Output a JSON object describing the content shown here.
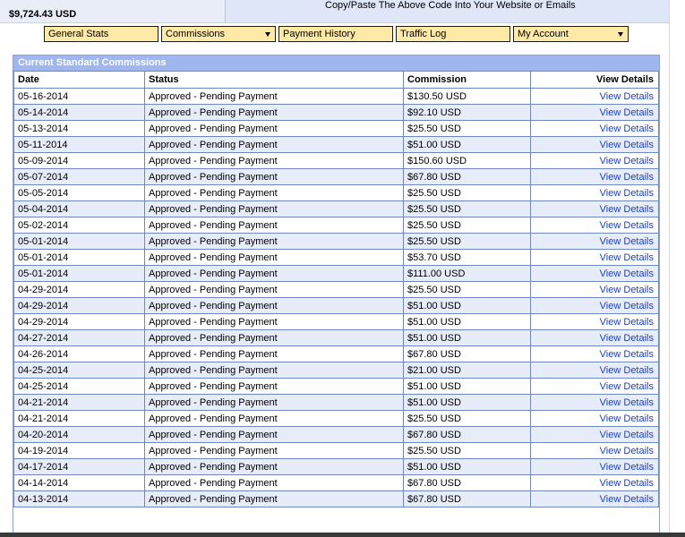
{
  "header": {
    "balance": "$9,724.43 USD",
    "copy_note": "Copy/Paste The Above Code Into Your Website or Emails"
  },
  "nav": [
    {
      "label": "General Stats",
      "dropdown": false
    },
    {
      "label": "Commissions",
      "dropdown": true
    },
    {
      "label": "Payment History",
      "dropdown": false
    },
    {
      "label": "Traffic Log",
      "dropdown": false
    },
    {
      "label": "My Account",
      "dropdown": true
    }
  ],
  "panel": {
    "title": "Current Standard Commissions",
    "columns": [
      "Date",
      "Status",
      "Commission",
      "View Details"
    ],
    "rows": [
      {
        "date": "05-16-2014",
        "status": "Approved - Pending Payment",
        "commission": "$130.50 USD",
        "link": "View Details"
      },
      {
        "date": "05-14-2014",
        "status": "Approved - Pending Payment",
        "commission": "$92.10 USD",
        "link": "View Details"
      },
      {
        "date": "05-13-2014",
        "status": "Approved - Pending Payment",
        "commission": "$25.50 USD",
        "link": "View Details"
      },
      {
        "date": "05-11-2014",
        "status": "Approved - Pending Payment",
        "commission": "$51.00 USD",
        "link": "View Details"
      },
      {
        "date": "05-09-2014",
        "status": "Approved - Pending Payment",
        "commission": "$150.60 USD",
        "link": "View Details"
      },
      {
        "date": "05-07-2014",
        "status": "Approved - Pending Payment",
        "commission": "$67.80 USD",
        "link": "View Details"
      },
      {
        "date": "05-05-2014",
        "status": "Approved - Pending Payment",
        "commission": "$25.50 USD",
        "link": "View Details"
      },
      {
        "date": "05-04-2014",
        "status": "Approved - Pending Payment",
        "commission": "$25.50 USD",
        "link": "View Details"
      },
      {
        "date": "05-02-2014",
        "status": "Approved - Pending Payment",
        "commission": "$25.50 USD",
        "link": "View Details"
      },
      {
        "date": "05-01-2014",
        "status": "Approved - Pending Payment",
        "commission": "$25.50 USD",
        "link": "View Details"
      },
      {
        "date": "05-01-2014",
        "status": "Approved - Pending Payment",
        "commission": "$53.70 USD",
        "link": "View Details"
      },
      {
        "date": "05-01-2014",
        "status": "Approved - Pending Payment",
        "commission": "$111.00 USD",
        "link": "View Details"
      },
      {
        "date": "04-29-2014",
        "status": "Approved - Pending Payment",
        "commission": "$25.50 USD",
        "link": "View Details"
      },
      {
        "date": "04-29-2014",
        "status": "Approved - Pending Payment",
        "commission": "$51.00 USD",
        "link": "View Details"
      },
      {
        "date": "04-29-2014",
        "status": "Approved - Pending Payment",
        "commission": "$51.00 USD",
        "link": "View Details"
      },
      {
        "date": "04-27-2014",
        "status": "Approved - Pending Payment",
        "commission": "$51.00 USD",
        "link": "View Details"
      },
      {
        "date": "04-26-2014",
        "status": "Approved - Pending Payment",
        "commission": "$67.80 USD",
        "link": "View Details"
      },
      {
        "date": "04-25-2014",
        "status": "Approved - Pending Payment",
        "commission": "$21.00 USD",
        "link": "View Details"
      },
      {
        "date": "04-25-2014",
        "status": "Approved - Pending Payment",
        "commission": "$51.00 USD",
        "link": "View Details"
      },
      {
        "date": "04-21-2014",
        "status": "Approved - Pending Payment",
        "commission": "$51.00 USD",
        "link": "View Details"
      },
      {
        "date": "04-21-2014",
        "status": "Approved - Pending Payment",
        "commission": "$25.50 USD",
        "link": "View Details"
      },
      {
        "date": "04-20-2014",
        "status": "Approved - Pending Payment",
        "commission": "$67.80 USD",
        "link": "View Details"
      },
      {
        "date": "04-19-2014",
        "status": "Approved - Pending Payment",
        "commission": "$25.50 USD",
        "link": "View Details"
      },
      {
        "date": "04-17-2014",
        "status": "Approved - Pending Payment",
        "commission": "$51.00 USD",
        "link": "View Details"
      },
      {
        "date": "04-14-2014",
        "status": "Approved - Pending Payment",
        "commission": "$67.80 USD",
        "link": "View Details"
      },
      {
        "date": "04-13-2014",
        "status": "Approved - Pending Payment",
        "commission": "$67.80 USD",
        "link": "View Details"
      }
    ]
  },
  "colors": {
    "nav_button_bg": "#ffe9a6",
    "panel_header_bg": "#9fb6ee",
    "row_alt_bg": "#e7ecf9",
    "link": "#1c40c8",
    "grid_border": "#6e86c2"
  }
}
